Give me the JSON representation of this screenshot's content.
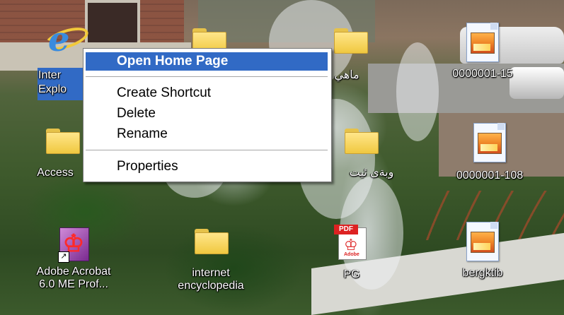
{
  "desktop": {
    "icons": [
      {
        "id": "ie",
        "line1": "Inter",
        "line2": "Explo"
      },
      {
        "id": "folder-top",
        "line1": ""
      },
      {
        "id": "folder-arabic1",
        "line1": "ماهي"
      },
      {
        "id": "img1",
        "line1": "0000001-15"
      },
      {
        "id": "folder-access",
        "line1": "Access"
      },
      {
        "id": "folder-arabic2",
        "line1": "وبةى ئيت"
      },
      {
        "id": "img2",
        "line1": "0000001-108"
      },
      {
        "id": "acrobat",
        "line1": "Adobe Acrobat",
        "line2": "6.0 ME Prof..."
      },
      {
        "id": "folder-encyclopedia",
        "line1": "internet",
        "line2": "encyclopedia"
      },
      {
        "id": "pdf",
        "line1": "PG"
      },
      {
        "id": "img3",
        "line1": "bergktib"
      }
    ],
    "pdf_tag": "PDF",
    "pdf_brand": "Adobe"
  },
  "context_menu": {
    "items": [
      {
        "label": "Open Home Page",
        "default": true,
        "highlighted": true
      },
      {
        "label": "Create Shortcut"
      },
      {
        "label": "Delete"
      },
      {
        "label": "Rename"
      },
      {
        "label": "Properties"
      }
    ]
  },
  "colors": {
    "selection": "#316ac5",
    "menu_bg": "#ffffff",
    "folder": "#f0c840"
  }
}
